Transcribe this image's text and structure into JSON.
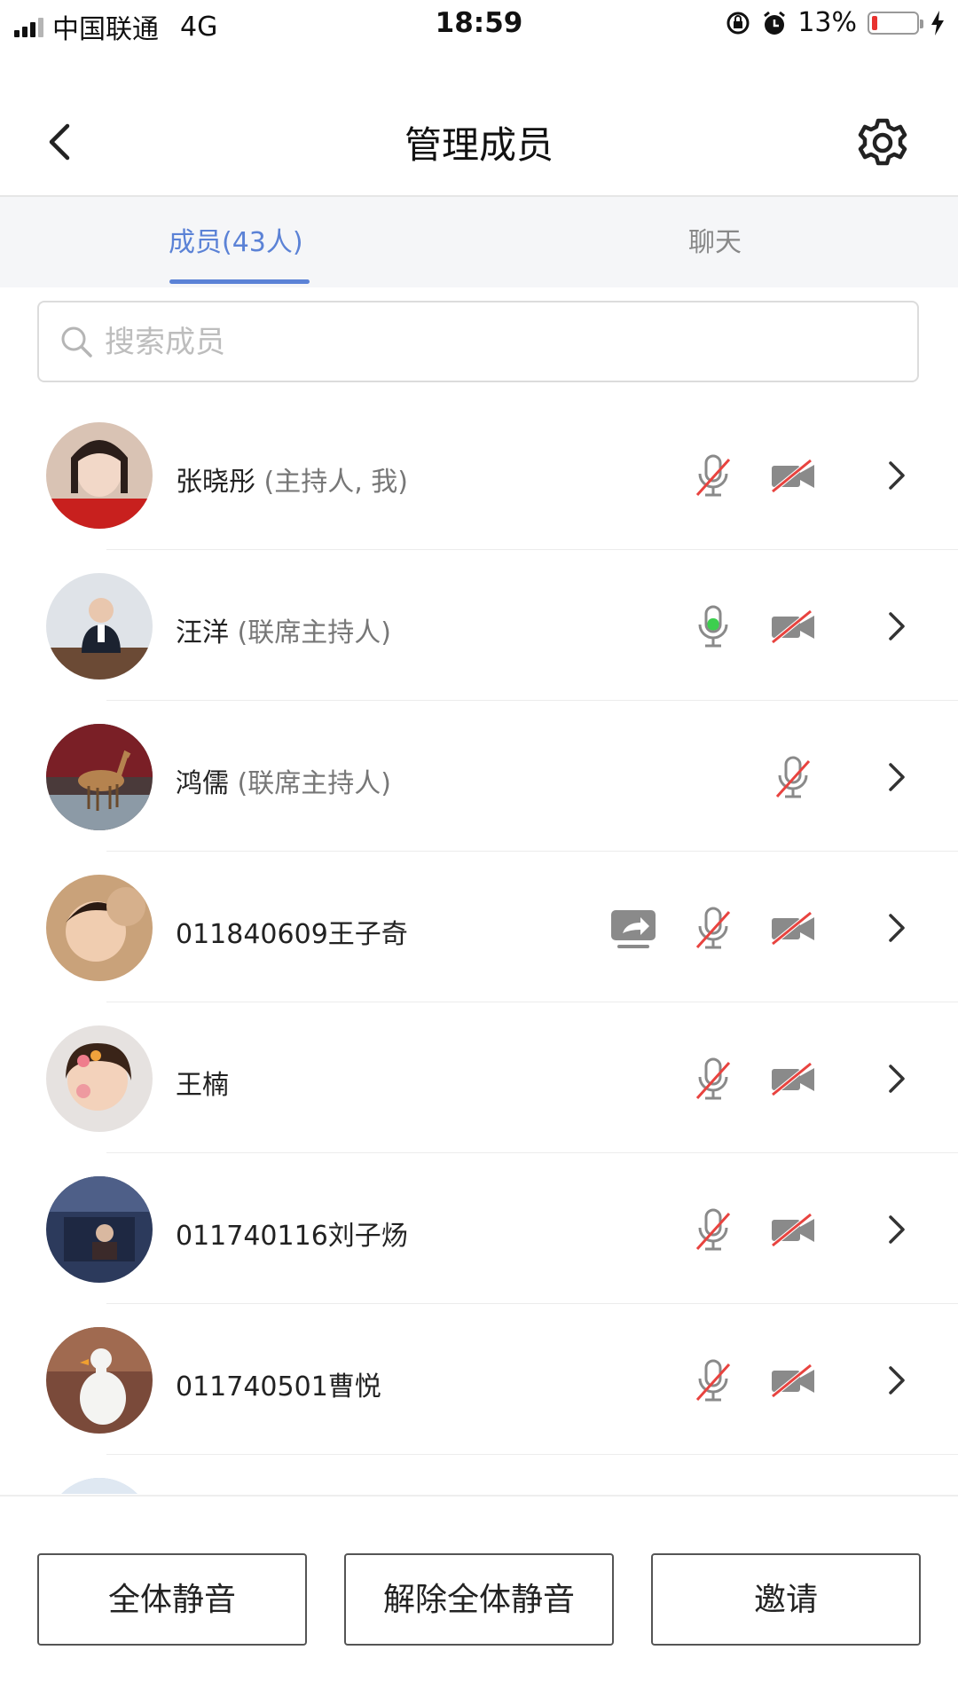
{
  "status_bar": {
    "carrier": "中国联通",
    "network": "4G",
    "time": "18:59",
    "battery_text": "13%",
    "battery_level": 0.13
  },
  "header": {
    "title": "管理成员",
    "back_icon": "chevron-left-icon",
    "settings_icon": "gear-icon"
  },
  "tabs": [
    {
      "label": "成员(43人)",
      "active": true
    },
    {
      "label": "聊天",
      "active": false
    }
  ],
  "search": {
    "placeholder": "搜索成员",
    "value": ""
  },
  "members": [
    {
      "name": "张晓彤",
      "role": " (主持人, 我)",
      "screen_share": false,
      "mic": "muted",
      "camera": "off"
    },
    {
      "name": "汪洋",
      "role": " (联席主持人)",
      "screen_share": false,
      "mic": "speaking",
      "camera": "off"
    },
    {
      "name": "鸿儒",
      "role": " (联席主持人)",
      "screen_share": false,
      "mic": "muted",
      "camera": "none"
    },
    {
      "name": "011840609王子奇",
      "role": "",
      "screen_share": true,
      "mic": "muted",
      "camera": "off"
    },
    {
      "name": " 王楠",
      "role": "",
      "screen_share": false,
      "mic": "muted",
      "camera": "off"
    },
    {
      "name": "011740116刘子炀",
      "role": "",
      "screen_share": false,
      "mic": "muted",
      "camera": "off"
    },
    {
      "name": "011740501曹悦",
      "role": "",
      "screen_share": false,
      "mic": "muted",
      "camera": "off"
    }
  ],
  "footer": {
    "mute_all": "全体静音",
    "unmute_all": "解除全体静音",
    "invite": "邀请"
  },
  "colors": {
    "accent": "#5b82d6",
    "muted_slash": "#e8433f",
    "speaking": "#3ccf4e",
    "icon_gray": "#8a8a8a"
  }
}
